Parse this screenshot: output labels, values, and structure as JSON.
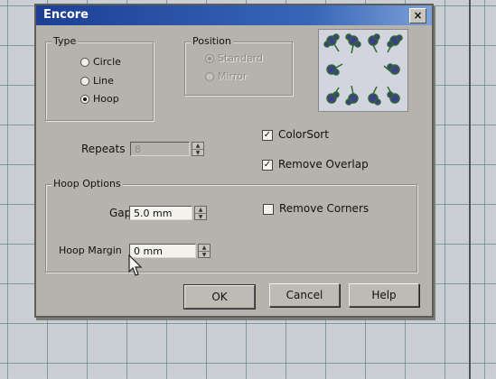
{
  "window": {
    "title": "Encore",
    "close_label": "×"
  },
  "type_group": {
    "label": "Type",
    "options": [
      {
        "label": "Circle",
        "checked": false
      },
      {
        "label": "Line",
        "checked": false
      },
      {
        "label": "Hoop",
        "checked": true
      }
    ]
  },
  "position_group": {
    "label": "Position",
    "options": [
      {
        "label": "Standard",
        "checked": true,
        "disabled": true
      },
      {
        "label": "Mirror",
        "checked": false,
        "disabled": true
      }
    ]
  },
  "preview": {
    "icon": "flower-pattern-preview",
    "flower_color": "#3b3f8c",
    "stem_color": "#2f6a2a"
  },
  "repeats": {
    "label": "Repeats",
    "value": "8",
    "disabled": true
  },
  "colorsort": {
    "label": "ColorSort",
    "checked": true
  },
  "remove_overlap": {
    "label": "Remove Overlap",
    "checked": true
  },
  "hoop_options": {
    "label": "Hoop Options",
    "gap": {
      "label": "Gap",
      "value": "5.0 mm"
    },
    "remove_corners": {
      "label": "Remove Corners",
      "checked": false
    },
    "hoop_margin": {
      "label": "Hoop Margin",
      "value": "0 mm"
    }
  },
  "buttons": {
    "ok": "OK",
    "cancel": "Cancel",
    "help": "Help"
  },
  "check_glyph": "✓",
  "spin_up": "▲",
  "spin_down": "▼"
}
